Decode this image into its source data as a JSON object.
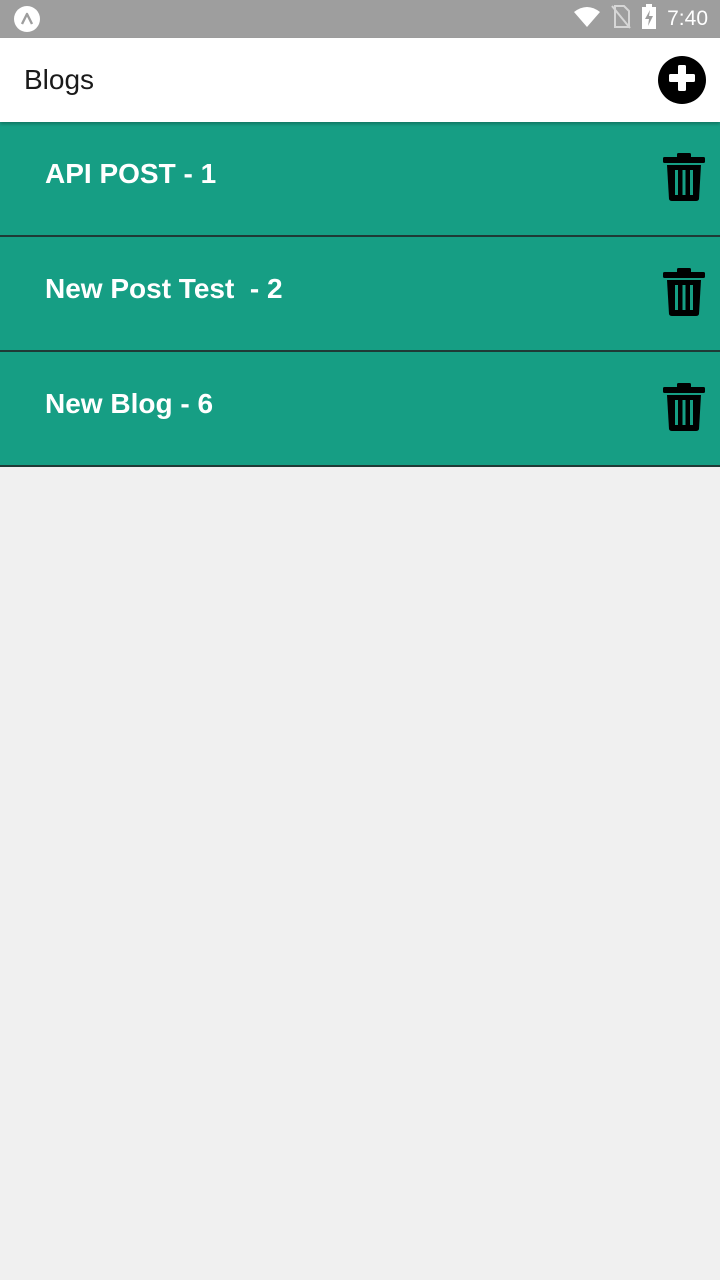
{
  "status_bar": {
    "time": "7:40",
    "icons": [
      "app-icon",
      "wifi-icon",
      "no-sim-icon",
      "battery-charging-icon"
    ]
  },
  "header": {
    "title": "Blogs",
    "add_icon": "plus-circle-icon"
  },
  "blogs": [
    {
      "title": "API POST - 1",
      "delete_icon": "trash-icon"
    },
    {
      "title": "New Post Test  - 2",
      "delete_icon": "trash-icon"
    },
    {
      "title": "New Blog - 6",
      "delete_icon": "trash-icon"
    }
  ],
  "colors": {
    "status_bar": "#9e9e9e",
    "header_bg": "#ffffff",
    "item_bg": "#169e84",
    "item_border": "#1f3a36",
    "page_bg": "#f0f0f0"
  }
}
